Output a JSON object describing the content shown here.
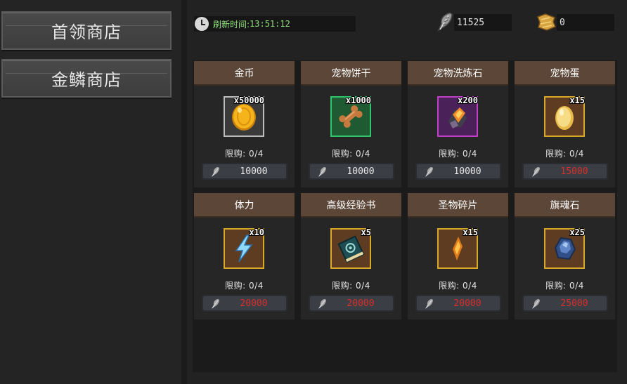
{
  "sidebar": {
    "tabs": [
      {
        "label": "首领商店"
      },
      {
        "label": "金鳞商店"
      }
    ]
  },
  "header": {
    "refresh_label": "刷新时间:",
    "refresh_time": "13:51:12",
    "currency_feather": "11525",
    "currency_scale": "0"
  },
  "colors": {
    "affordable": "#e8e8e8",
    "unaffordable": "#d9302a",
    "card_header": "#5b4637"
  },
  "shop": {
    "items": [
      {
        "name": "金币",
        "qty": "x50000",
        "limit": "限购: 0/4",
        "price": "10000",
        "affordable": true,
        "icon": "gold-coin-icon"
      },
      {
        "name": "宠物饼干",
        "qty": "x1000",
        "limit": "限购: 0/4",
        "price": "10000",
        "affordable": true,
        "icon": "bone-biscuit-icon"
      },
      {
        "name": "宠物洗炼石",
        "qty": "x200",
        "limit": "限购: 0/4",
        "price": "10000",
        "affordable": true,
        "icon": "refine-stone-icon"
      },
      {
        "name": "宠物蛋",
        "qty": "x15",
        "limit": "限购: 0/4",
        "price": "15000",
        "affordable": false,
        "icon": "pet-egg-icon"
      },
      {
        "name": "体力",
        "qty": "x10",
        "limit": "限购: 0/4",
        "price": "20000",
        "affordable": false,
        "icon": "lightning-icon"
      },
      {
        "name": "高级经验书",
        "qty": "x5",
        "limit": "限购: 0/4",
        "price": "20000",
        "affordable": false,
        "icon": "exp-book-icon"
      },
      {
        "name": "圣物碎片",
        "qty": "x15",
        "limit": "限购: 0/4",
        "price": "20000",
        "affordable": false,
        "icon": "relic-shard-icon"
      },
      {
        "name": "旗魂石",
        "qty": "x25",
        "limit": "限购: 0/4",
        "price": "25000",
        "affordable": false,
        "icon": "soul-stone-icon"
      }
    ]
  }
}
